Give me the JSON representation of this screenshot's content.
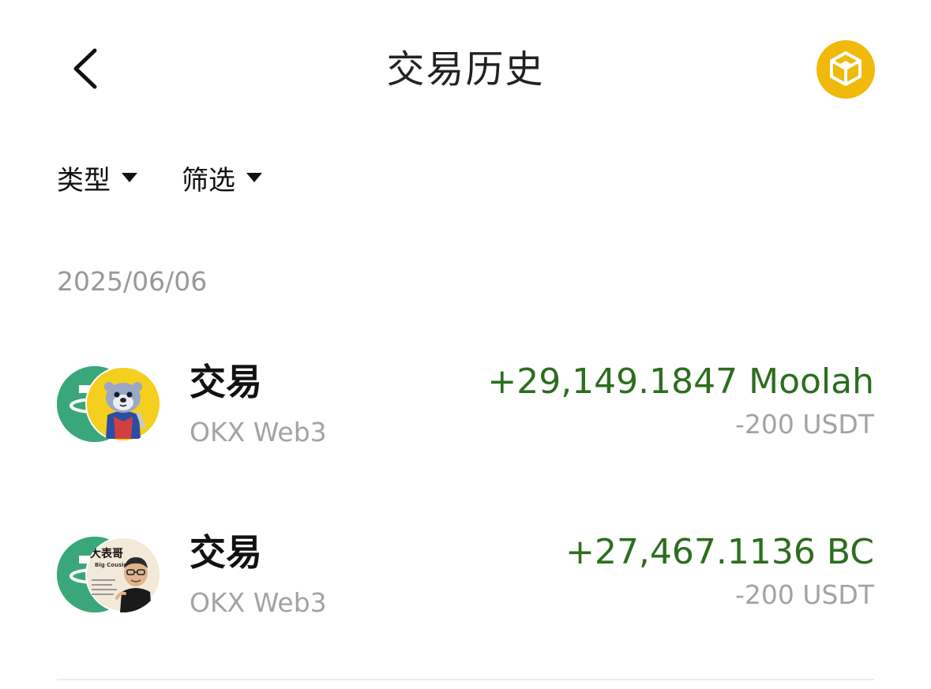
{
  "header": {
    "title": "交易历史",
    "back_icon": "chevron-left-icon",
    "wallet_icon": "bnb-cube-icon",
    "wallet_color": "#f0b90b"
  },
  "filters": [
    {
      "label": "类型"
    },
    {
      "label": "筛选"
    }
  ],
  "date": "2025/06/06",
  "transactions": [
    {
      "title": "交易",
      "source": "OKX Web3",
      "amount": "+29,149.1847 Moolah",
      "cost": "-200 USDT",
      "base_icon": "usdt-icon",
      "token_icon": "moolah-otter-icon"
    },
    {
      "title": "交易",
      "source": "OKX Web3",
      "amount": "+27,467.1136 BC",
      "cost": "-200 USDT",
      "base_icon": "usdt-icon",
      "token_icon": "big-cousin-icon",
      "token_caption_title": "大表哥",
      "token_caption_subtitle": "Big Cousin"
    }
  ],
  "colors": {
    "positive": "#2c6e1e",
    "muted": "#a3a3a3",
    "usdt": "#3aa77b"
  }
}
